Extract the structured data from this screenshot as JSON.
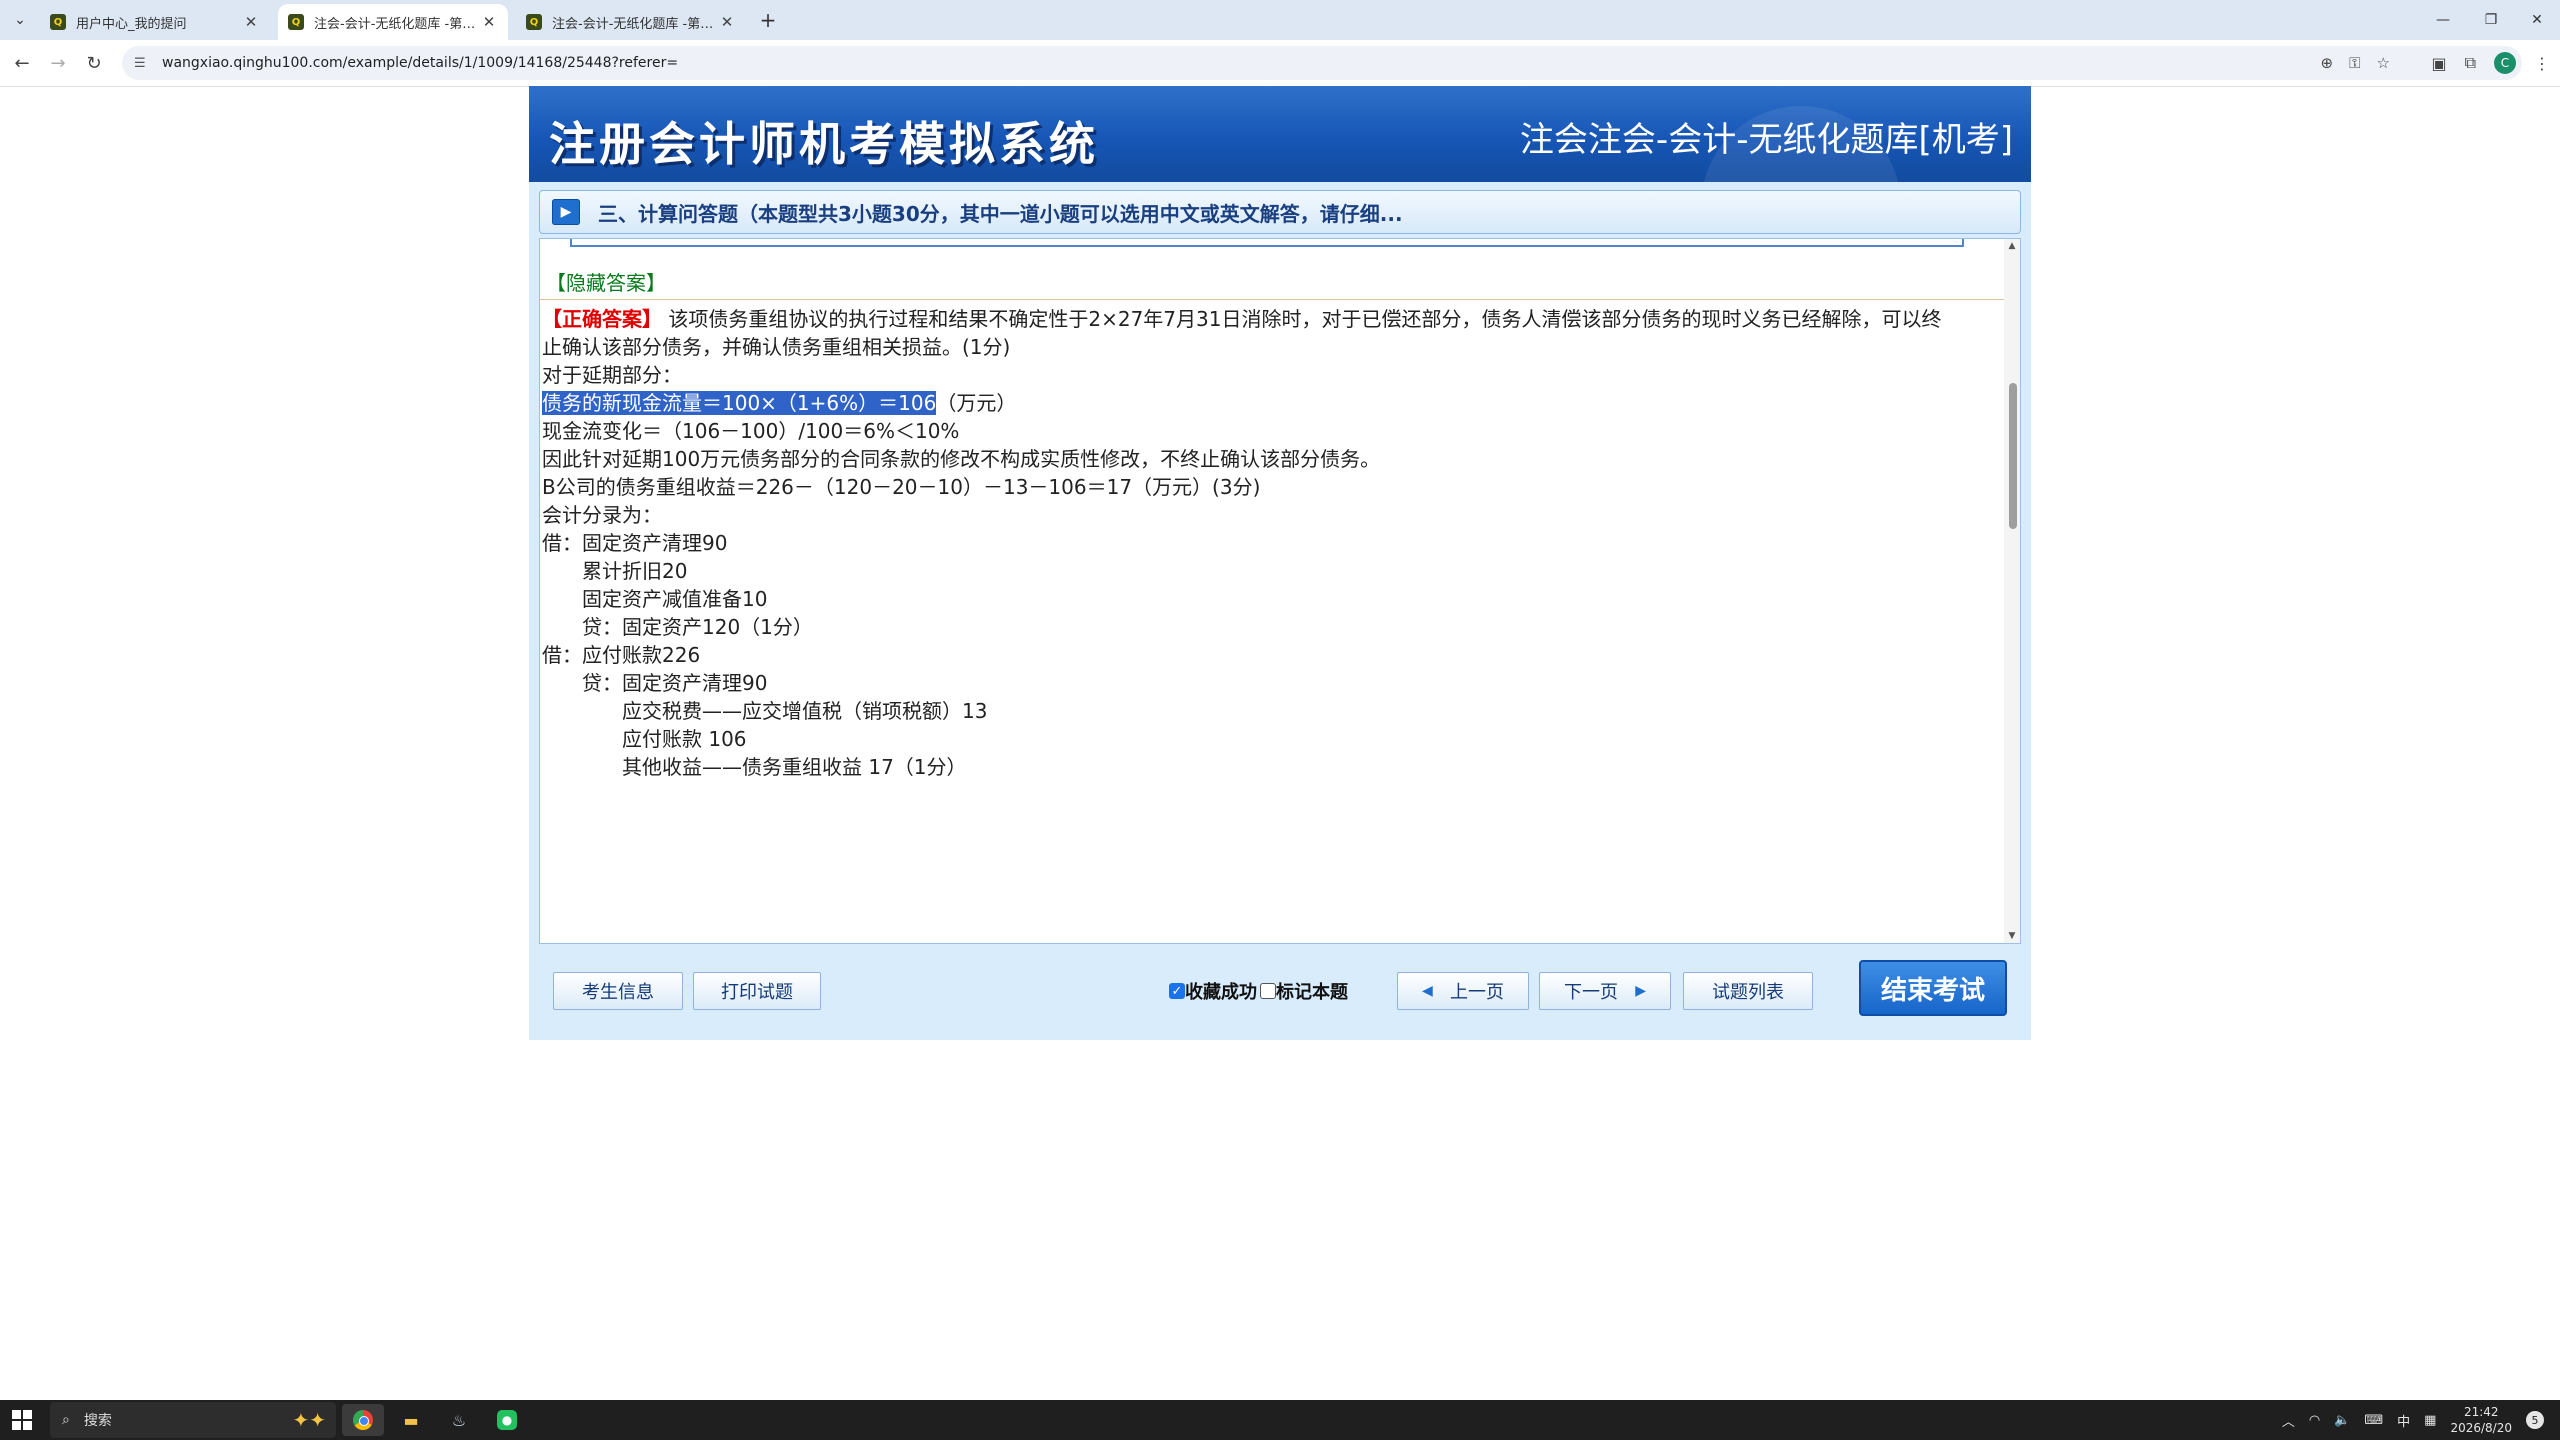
{
  "browser": {
    "tabs": [
      {
        "title": "用户中心_我的提问",
        "active": false
      },
      {
        "title": "注会-会计-无纸化题库 -第二十",
        "active": true
      },
      {
        "title": "注会-会计-无纸化题库 -第二十",
        "active": false
      }
    ],
    "favicon_text": "Q",
    "url": "wangxiao.qinghu100.com/example/details/1/1009/14168/25448?referer=",
    "profile_initial": "C"
  },
  "app": {
    "banner_title": "注册会计师机考模拟系统",
    "banner_subtitle": "注会注会-会计-无纸化题库[机考]",
    "question_header": "三、计算问答题（本题型共3小题30分，其中一道小题可以选用中文或英文解答，请仔细...",
    "hidden_answer_label": "【隐藏答案】",
    "answer": {
      "correct_label_open": "【",
      "correct_label": "正确答案",
      "correct_label_close": "】",
      "intro_line1": " 该项债务重组协议的执行过程和结果不确定性于2×27年7月31日消除时，对于已偿还部分，债务人清偿该部分债务的现时义务已经解除，可以终",
      "intro_line2": "止确认该部分债务，并确认债务重组相关损益。(1分)",
      "lines": [
        "对于延期部分：",
        "现金流变化＝（106－100）/100＝6%＜10%",
        "因此针对延期100万元债务部分的合同条款的修改不构成实质性修改，不终止确认该部分债务。",
        "B公司的债务重组收益＝226－（120－20－10）－13－106＝17（万元）(3分)",
        "会计分录为：",
        "借：固定资产清理90",
        "　　累计折旧20",
        "　　固定资产减值准备10",
        "　　贷：固定资产120（1分）",
        "借：应付账款226",
        "　　贷：固定资产清理90",
        "　　　　应交税费——应交增值税（销项税额）13",
        "　　　　应付账款 106",
        "　　　　其他收益——债务重组收益 17（1分）"
      ],
      "highlight_text": "债务的新现金流量＝100×（1+6%）＝106",
      "highlight_suffix": "（万元）"
    },
    "buttons": {
      "candidate_info": "考生信息",
      "print": "打印试题",
      "favorite_label": "收藏成功",
      "favorite_checked": true,
      "mark_label": "标记本题",
      "mark_checked": false,
      "prev": "上一页",
      "next": "下一页",
      "question_list": "试题列表",
      "end_exam": "结束考试"
    }
  },
  "taskbar": {
    "search_placeholder": "搜索",
    "ime": "中",
    "time": "21:42",
    "date": "2026/8/20",
    "notifications": "5"
  }
}
